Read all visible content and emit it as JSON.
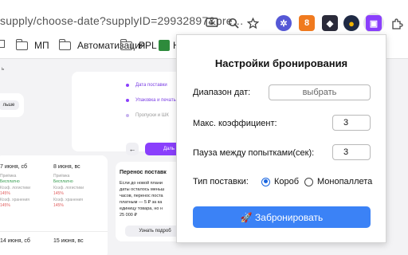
{
  "browser": {
    "url": "supply/choose-date?supplyID=29932897&pre…",
    "icons": {
      "install": "install-icon",
      "zoom": "zoom-icon",
      "bookmark": "star-icon",
      "extensions": "puzzle-icon"
    },
    "extensions": [
      {
        "name": "ext-blue-icon",
        "glyph": "✲",
        "color": "#5558d6"
      },
      {
        "name": "ext-number-icon",
        "glyph": "8",
        "color": "#f07a1f"
      },
      {
        "name": "ext-dark-icon",
        "glyph": "◆",
        "color": "#2b2b3a"
      },
      {
        "name": "ext-yellow-icon",
        "glyph": "●",
        "color": "#f2b400"
      },
      {
        "name": "ext-purple-icon",
        "glyph": "▣",
        "color": "#8a3ffc"
      }
    ],
    "bookmarks": [
      {
        "label": "МП"
      },
      {
        "label": "Автоматизация"
      },
      {
        "label": "PPL"
      },
      {
        "label": "Н"
      }
    ]
  },
  "page": {
    "steps": {
      "step1": "Дата поставки",
      "step2": "Упаковка и печать",
      "step3": "Пропуски и ШК",
      "next_label": "Даль"
    },
    "left_button": "льше",
    "days": [
      {
        "date": "7 июня, сб",
        "accept": "Приёмка",
        "free": "Бесплатно",
        "log": "Коэф. логистики",
        "log_val": "145%",
        "store": "Коэф. хранения",
        "store_val": "145%"
      },
      {
        "date": "8 июня, вс",
        "accept": "Приёмка",
        "free": "Бесплатно",
        "log": "Коэф. логистики",
        "log_val": "145%",
        "store": "Коэф. хранения",
        "store_val": "145%"
      }
    ],
    "next_days": [
      "14 июня, сб",
      "15 июня, вс"
    ],
    "transfer": {
      "title": "Перенос поставк",
      "lines": [
        "Если до новой плани",
        "даты осталось меньш",
        "часов, перенос поста",
        "платным — 5 ₽ за ка",
        "единицу товара, но н",
        "25 000 ₽"
      ],
      "button": "Узнать подроб"
    }
  },
  "popup": {
    "title": "Настройки бронирования",
    "date_range_label": "Диапазон дат:",
    "date_range_value": "выбрать",
    "max_coef_label": "Макс. коэффициент:",
    "max_coef_value": "3",
    "pause_label": "Пауза между попытками(сек):",
    "pause_value": "3",
    "supply_type_label": "Тип поставки:",
    "options": [
      "Короб",
      "Монопаллета"
    ],
    "selected_option": "Короб",
    "book_button": "🚀 Забронировать"
  },
  "colors": {
    "accent_blue": "#3b82f6",
    "radio_blue": "#1a66e0",
    "brand_purple": "#8a3ffc"
  }
}
